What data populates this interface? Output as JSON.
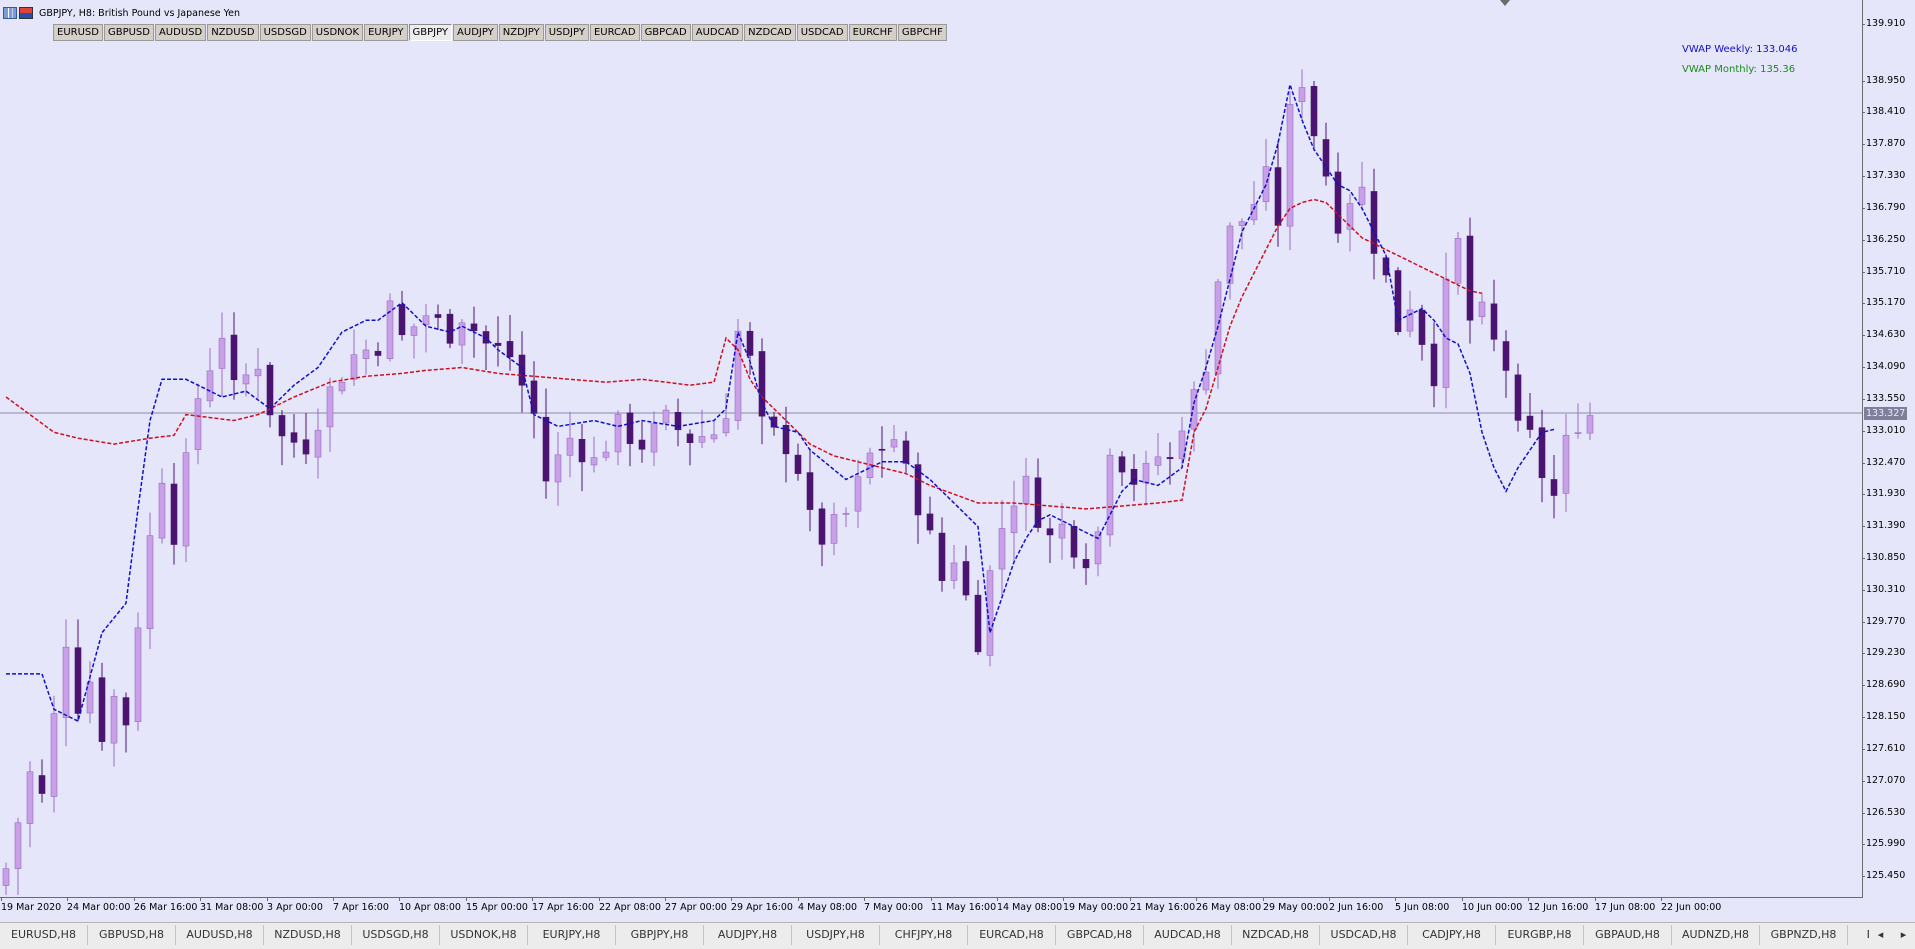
{
  "window": {
    "title": "GBPJPY, H8:  British Pound vs Japanese Yen",
    "bg_color": "#e6e6fa"
  },
  "symbol_buttons": [
    {
      "label": "EURUSD",
      "active": false
    },
    {
      "label": "GBPUSD",
      "active": false
    },
    {
      "label": "AUDUSD",
      "active": false
    },
    {
      "label": "NZDUSD",
      "active": false
    },
    {
      "label": "USDSGD",
      "active": false
    },
    {
      "label": "USDNOK",
      "active": false
    },
    {
      "label": "EURJPY",
      "active": false
    },
    {
      "label": "GBPJPY",
      "active": true
    },
    {
      "label": "AUDJPY",
      "active": false
    },
    {
      "label": "NZDJPY",
      "active": false
    },
    {
      "label": "USDJPY",
      "active": false
    },
    {
      "label": "EURCAD",
      "active": false
    },
    {
      "label": "GBPCAD",
      "active": false
    },
    {
      "label": "AUDCAD",
      "active": false
    },
    {
      "label": "NZDCAD",
      "active": false
    },
    {
      "label": "USDCAD",
      "active": false
    },
    {
      "label": "EURCHF",
      "active": false
    },
    {
      "label": "GBPCHF",
      "active": false
    }
  ],
  "indicators": {
    "weekly": {
      "label": "VWAP Weekly: 133.046",
      "color": "#1010c8"
    },
    "monthly": {
      "label": "VWAP Monthly: 135.36",
      "color": "#1a8a1a"
    },
    "monthly_line_color": "#cc1020"
  },
  "price_axis": {
    "ticks": [
      "139.910",
      "138.950",
      "138.410",
      "137.870",
      "137.330",
      "136.790",
      "136.250",
      "135.710",
      "135.170",
      "134.630",
      "134.090",
      "133.550",
      "133.010",
      "132.470",
      "131.930",
      "131.390",
      "130.850",
      "130.310",
      "129.770",
      "129.230",
      "128.690",
      "128.150",
      "127.610",
      "127.070",
      "126.530",
      "125.990",
      "125.450"
    ],
    "current_price": "133.327"
  },
  "time_axis": {
    "ticks": [
      "19 Mar 2020",
      "24 Mar 00:00",
      "26 Mar 16:00",
      "31 Mar 08:00",
      "3 Apr 00:00",
      "7 Apr 16:00",
      "10 Apr 08:00",
      "15 Apr 00:00",
      "17 Apr 16:00",
      "22 Apr 08:00",
      "27 Apr 00:00",
      "29 Apr 16:00",
      "4 May 08:00",
      "7 May 00:00",
      "11 May 16:00",
      "14 May 08:00",
      "19 May 00:00",
      "21 May 16:00",
      "26 May 08:00",
      "29 May 00:00",
      "2 Jun 16:00",
      "5 Jun 08:00",
      "10 Jun 00:00",
      "12 Jun 16:00",
      "17 Jun 08:00",
      "22 Jun 00:00"
    ]
  },
  "chart_tabs": [
    "EURUSD,H8",
    "GBPUSD,H8",
    "AUDUSD,H8",
    "NZDUSD,H8",
    "USDSGD,H8",
    "USDNOK,H8",
    "EURJPY,H8",
    "GBPJPY,H8",
    "AUDJPY,H8",
    "USDJPY,H8",
    "CHFJPY,H8",
    "EURCAD,H8",
    "GBPCAD,H8",
    "AUDCAD,H8",
    "NZDCAD,H8",
    "USDCAD,H8",
    "CADJPY,H8",
    "EURGBP,H8",
    "GBPAUD,H8",
    "AUDNZD,H8",
    "GBPNZD,H8",
    "EURAUD,"
  ],
  "tab_arrows": {
    "left": "◂",
    "right": "▸"
  },
  "chart_data": {
    "type": "candlestick",
    "symbol": "GBPJPY",
    "timeframe": "H8",
    "ylim": [
      125.2,
      140.2
    ],
    "up_color": "#c8a0e6",
    "down_color": "#4a1470",
    "close_path": [
      [
        0,
        125.6
      ],
      [
        2,
        127.2
      ],
      [
        3,
        126.8
      ],
      [
        5,
        129.5
      ],
      [
        6,
        128.4
      ],
      [
        7,
        128.8
      ],
      [
        8,
        127.9
      ],
      [
        9,
        128.5
      ],
      [
        10,
        128.1
      ],
      [
        11,
        129.8
      ],
      [
        12,
        131.2
      ],
      [
        13,
        132.3
      ],
      [
        14,
        131.3
      ],
      [
        16,
        133.6
      ],
      [
        18,
        134.7
      ],
      [
        19,
        133.7
      ],
      [
        21,
        134.2
      ],
      [
        22,
        133.4
      ],
      [
        23,
        132.9
      ],
      [
        25,
        132.8
      ],
      [
        27,
        133.7
      ],
      [
        29,
        134.3
      ],
      [
        31,
        134.5
      ],
      [
        32,
        135.1
      ],
      [
        33,
        134.6
      ],
      [
        35,
        135.0
      ],
      [
        37,
        134.7
      ],
      [
        38,
        135.0
      ],
      [
        40,
        134.5
      ],
      [
        42,
        134.3
      ],
      [
        44,
        133.3
      ],
      [
        45,
        132.2
      ],
      [
        47,
        132.9
      ],
      [
        49,
        132.5
      ],
      [
        51,
        133.1
      ],
      [
        53,
        132.8
      ],
      [
        55,
        133.2
      ],
      [
        57,
        132.9
      ],
      [
        59,
        133.0
      ],
      [
        60,
        133.4
      ],
      [
        61,
        134.7
      ],
      [
        62,
        134.2
      ],
      [
        63,
        133.1
      ],
      [
        65,
        132.8
      ],
      [
        66,
        132.4
      ],
      [
        67,
        131.5
      ],
      [
        68,
        131.2
      ],
      [
        70,
        131.6
      ],
      [
        71,
        132.1
      ],
      [
        72,
        132.6
      ],
      [
        74,
        132.9
      ],
      [
        75,
        132.3
      ],
      [
        76,
        131.8
      ],
      [
        77,
        131.2
      ],
      [
        78,
        130.5
      ],
      [
        79,
        130.9
      ],
      [
        80,
        130.2
      ],
      [
        81,
        129.5
      ],
      [
        82,
        130.6
      ],
      [
        83,
        131.4
      ],
      [
        84,
        131.9
      ],
      [
        85,
        132.1
      ],
      [
        86,
        131.6
      ],
      [
        87,
        131.2
      ],
      [
        88,
        131.4
      ],
      [
        89,
        131.1
      ],
      [
        90,
        130.9
      ],
      [
        91,
        131.3
      ],
      [
        92,
        132.8
      ],
      [
        93,
        132.5
      ],
      [
        94,
        132.2
      ],
      [
        95,
        132.3
      ],
      [
        96,
        132.6
      ],
      [
        97,
        132.5
      ],
      [
        98,
        133.2
      ],
      [
        99,
        133.6
      ],
      [
        100,
        134.2
      ],
      [
        101,
        135.6
      ],
      [
        102,
        136.4
      ],
      [
        103,
        136.6
      ],
      [
        104,
        136.9
      ],
      [
        105,
        137.3
      ],
      [
        106,
        136.6
      ],
      [
        107,
        138.4
      ],
      [
        108,
        139.0
      ],
      [
        109,
        138.1
      ],
      [
        110,
        137.4
      ],
      [
        111,
        136.6
      ],
      [
        112,
        137.0
      ],
      [
        113,
        137.1
      ],
      [
        114,
        136.2
      ],
      [
        115,
        135.6
      ],
      [
        116,
        134.8
      ],
      [
        117,
        135.2
      ],
      [
        118,
        134.6
      ],
      [
        119,
        134.0
      ],
      [
        120,
        135.4
      ],
      [
        121,
        136.2
      ],
      [
        122,
        134.9
      ],
      [
        123,
        135.0
      ],
      [
        124,
        134.5
      ],
      [
        125,
        134.1
      ],
      [
        126,
        133.0
      ],
      [
        127,
        132.9
      ],
      [
        128,
        132.3
      ],
      [
        129,
        131.9
      ],
      [
        130,
        132.8
      ],
      [
        131,
        133.2
      ],
      [
        132,
        133.3
      ]
    ],
    "vwap_weekly_path": [
      [
        0,
        128.9
      ],
      [
        3,
        128.9
      ],
      [
        4,
        128.3
      ],
      [
        6,
        128.1
      ],
      [
        8,
        129.6
      ],
      [
        10,
        130.1
      ],
      [
        11,
        131.7
      ],
      [
        12,
        133.2
      ],
      [
        13,
        133.9
      ],
      [
        15,
        133.9
      ],
      [
        18,
        133.6
      ],
      [
        20,
        133.7
      ],
      [
        22,
        133.4
      ],
      [
        24,
        133.8
      ],
      [
        26,
        134.1
      ],
      [
        28,
        134.7
      ],
      [
        30,
        134.9
      ],
      [
        31,
        134.9
      ],
      [
        33,
        135.2
      ],
      [
        35,
        134.8
      ],
      [
        37,
        134.7
      ],
      [
        38,
        134.8
      ],
      [
        40,
        134.6
      ],
      [
        41,
        134.4
      ],
      [
        43,
        134.1
      ],
      [
        44,
        133.3
      ],
      [
        46,
        133.1
      ],
      [
        49,
        133.2
      ],
      [
        51,
        133.1
      ],
      [
        53,
        133.2
      ],
      [
        56,
        133.1
      ],
      [
        59,
        133.2
      ],
      [
        60,
        133.4
      ],
      [
        61,
        134.7
      ],
      [
        62,
        134.2
      ],
      [
        63,
        133.5
      ],
      [
        64,
        133.1
      ],
      [
        66,
        133.0
      ],
      [
        67,
        132.7
      ],
      [
        70,
        132.2
      ],
      [
        71,
        132.3
      ],
      [
        73,
        132.5
      ],
      [
        75,
        132.5
      ],
      [
        77,
        132.2
      ],
      [
        79,
        131.8
      ],
      [
        81,
        131.4
      ],
      [
        82,
        129.6
      ],
      [
        83,
        130.2
      ],
      [
        84,
        130.8
      ],
      [
        85,
        131.2
      ],
      [
        86,
        131.5
      ],
      [
        87,
        131.6
      ],
      [
        89,
        131.4
      ],
      [
        91,
        131.2
      ],
      [
        92,
        131.6
      ],
      [
        93,
        132.0
      ],
      [
        94,
        132.2
      ],
      [
        96,
        132.1
      ],
      [
        98,
        132.4
      ],
      [
        99,
        133.5
      ],
      [
        100,
        134.1
      ],
      [
        101,
        134.8
      ],
      [
        102,
        135.6
      ],
      [
        103,
        136.4
      ],
      [
        104,
        136.8
      ],
      [
        105,
        137.2
      ],
      [
        106,
        137.9
      ],
      [
        107,
        138.9
      ],
      [
        108,
        138.3
      ],
      [
        109,
        137.8
      ],
      [
        110,
        137.5
      ],
      [
        111,
        137.2
      ],
      [
        112,
        137.1
      ],
      [
        113,
        136.8
      ],
      [
        114,
        136.4
      ],
      [
        115,
        136.0
      ],
      [
        116,
        134.9
      ],
      [
        117,
        135.0
      ],
      [
        118,
        135.1
      ],
      [
        119,
        134.9
      ],
      [
        120,
        134.6
      ],
      [
        121,
        134.5
      ],
      [
        122,
        134.0
      ],
      [
        123,
        133.0
      ],
      [
        124,
        132.4
      ],
      [
        125,
        132.0
      ],
      [
        126,
        132.4
      ],
      [
        127,
        132.7
      ],
      [
        128,
        133.0
      ],
      [
        129,
        133.05
      ]
    ],
    "vwap_monthly_path": [
      [
        0,
        133.6
      ],
      [
        2,
        133.3
      ],
      [
        4,
        133.0
      ],
      [
        6,
        132.9
      ],
      [
        9,
        132.8
      ],
      [
        12,
        132.9
      ],
      [
        14,
        132.95
      ],
      [
        15,
        133.3
      ],
      [
        17,
        133.25
      ],
      [
        19,
        133.2
      ],
      [
        21,
        133.3
      ],
      [
        24,
        133.6
      ],
      [
        27,
        133.85
      ],
      [
        30,
        133.95
      ],
      [
        33,
        134.0
      ],
      [
        35,
        134.05
      ],
      [
        38,
        134.1
      ],
      [
        41,
        134.0
      ],
      [
        44,
        133.95
      ],
      [
        47,
        133.9
      ],
      [
        50,
        133.85
      ],
      [
        53,
        133.9
      ],
      [
        55,
        133.85
      ],
      [
        57,
        133.8
      ],
      [
        59,
        133.85
      ],
      [
        60,
        134.6
      ],
      [
        61,
        134.4
      ],
      [
        62,
        133.9
      ],
      [
        63,
        133.6
      ],
      [
        65,
        133.2
      ],
      [
        67,
        132.8
      ],
      [
        69,
        132.6
      ],
      [
        71,
        132.5
      ],
      [
        73,
        132.4
      ],
      [
        75,
        132.3
      ],
      [
        77,
        132.1
      ],
      [
        79,
        131.95
      ],
      [
        81,
        131.8
      ],
      [
        84,
        131.8
      ],
      [
        87,
        131.75
      ],
      [
        90,
        131.7
      ],
      [
        93,
        131.75
      ],
      [
        96,
        131.8
      ],
      [
        98,
        131.85
      ],
      [
        99,
        133.0
      ],
      [
        100,
        133.4
      ],
      [
        101,
        134.1
      ],
      [
        102,
        134.8
      ],
      [
        103,
        135.3
      ],
      [
        104,
        135.7
      ],
      [
        105,
        136.1
      ],
      [
        106,
        136.5
      ],
      [
        107,
        136.8
      ],
      [
        108,
        136.9
      ],
      [
        109,
        136.95
      ],
      [
        110,
        136.9
      ],
      [
        111,
        136.7
      ],
      [
        112,
        136.5
      ],
      [
        113,
        136.3
      ],
      [
        114,
        136.2
      ],
      [
        115,
        136.1
      ],
      [
        116,
        136.0
      ],
      [
        117,
        135.9
      ],
      [
        118,
        135.8
      ],
      [
        119,
        135.7
      ],
      [
        120,
        135.6
      ],
      [
        121,
        135.5
      ],
      [
        122,
        135.4
      ],
      [
        123,
        135.36
      ]
    ]
  }
}
